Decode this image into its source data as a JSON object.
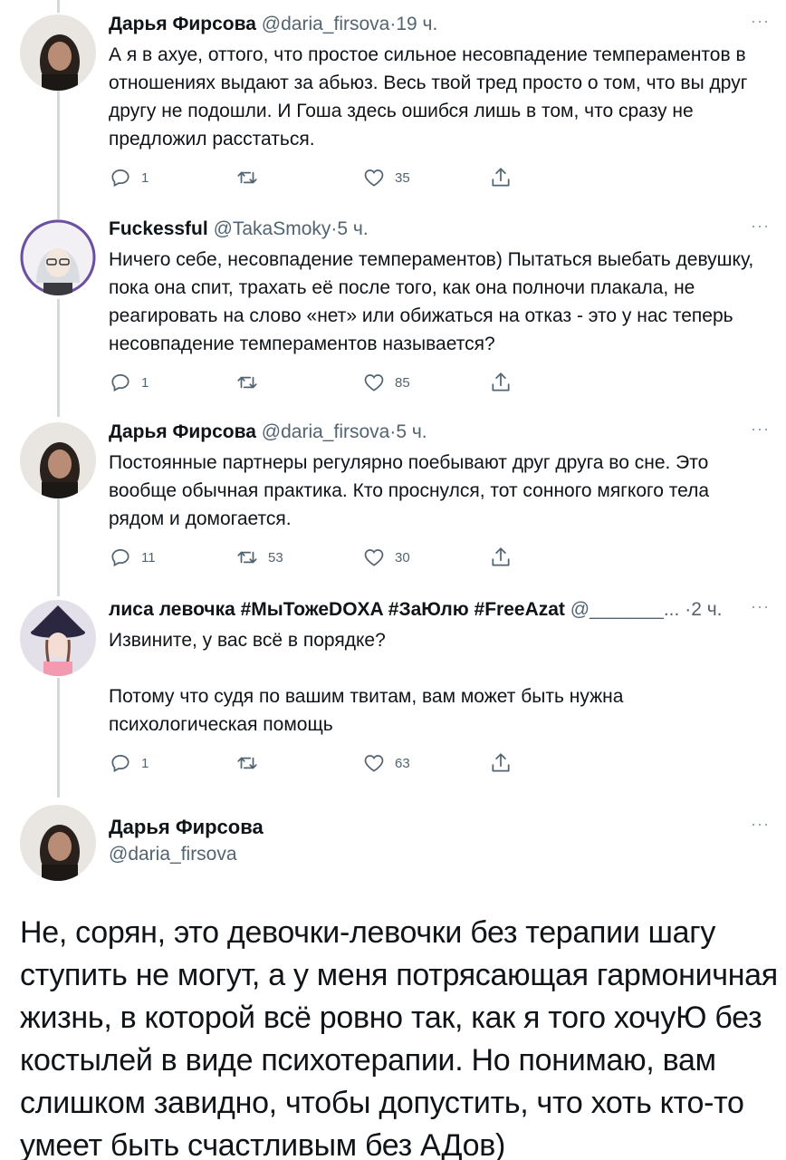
{
  "tweets": [
    {
      "name": "Дарья Фирсова",
      "handle": "@daria_firsova",
      "dot": "·",
      "time": "19 ч.",
      "text": "А я в ахуе, оттого, что простое сильное несовпадение темпераментов в отношениях выдают за абьюз. Весь твой тред просто о том, что вы друг другу не подошли. И Гоша здесь ошибся лишь в том, что сразу не предложил расстаться.",
      "replies": "1",
      "retweets": "",
      "likes": "35"
    },
    {
      "name": "Fuckessful",
      "handle": "@TakaSmoky",
      "dot": "·",
      "time": "5 ч.",
      "text": "Ничего себе, несовпадение темпераментов) Пытаться выебать девушку, пока она спит, трахать её после того, как она полночи плакала, не реагировать на слово «нет» или обижаться на отказ - это у нас теперь несовпадение темпераментов называется?",
      "replies": "1",
      "retweets": "",
      "likes": "85"
    },
    {
      "name": "Дарья Фирсова",
      "handle": "@daria_firsova",
      "dot": "·",
      "time": "5 ч.",
      "text": "Постоянные партнеры регулярно поебывают друг друга во сне. Это вообще обычная практика. Кто проснулся, тот сонного мягкого тела рядом и домогается.",
      "replies": "11",
      "retweets": "53",
      "likes": "30"
    },
    {
      "name": "лиса левочка #МыТожеDOXA #ЗаЮлю #FreeAzat",
      "handle": "@_______...",
      "dot": "·",
      "time": "2 ч.",
      "text": "Извините, у вас всё в порядке?\n\nПотому что судя по вашим твитам, вам может быть нужна психологическая помощь",
      "replies": "1",
      "retweets": "",
      "likes": "63"
    }
  ],
  "main_tweet": {
    "name": "Дарья Фирсова",
    "handle": "@daria_firsova",
    "text": "Не, сорян, это девочки-левочки без терапии шагу ступить не могут, а у меня потрясающая гармоничная жизнь, в которой всё ровно так, как я того хочуЮ без костылей в виде психотерапии. Но понимаю, вам слишком завидно, чтобы допустить, что хоть кто-то умеет быть счастливым без АДов)"
  },
  "more_label": "···",
  "icons": {
    "reply": "reply-icon",
    "retweet": "retweet-icon",
    "like": "heart-icon",
    "share": "share-icon",
    "more": "more-icon"
  },
  "colors": {
    "text": "#0f1419",
    "secondary": "#536471",
    "thread_line": "#cfd9de"
  }
}
